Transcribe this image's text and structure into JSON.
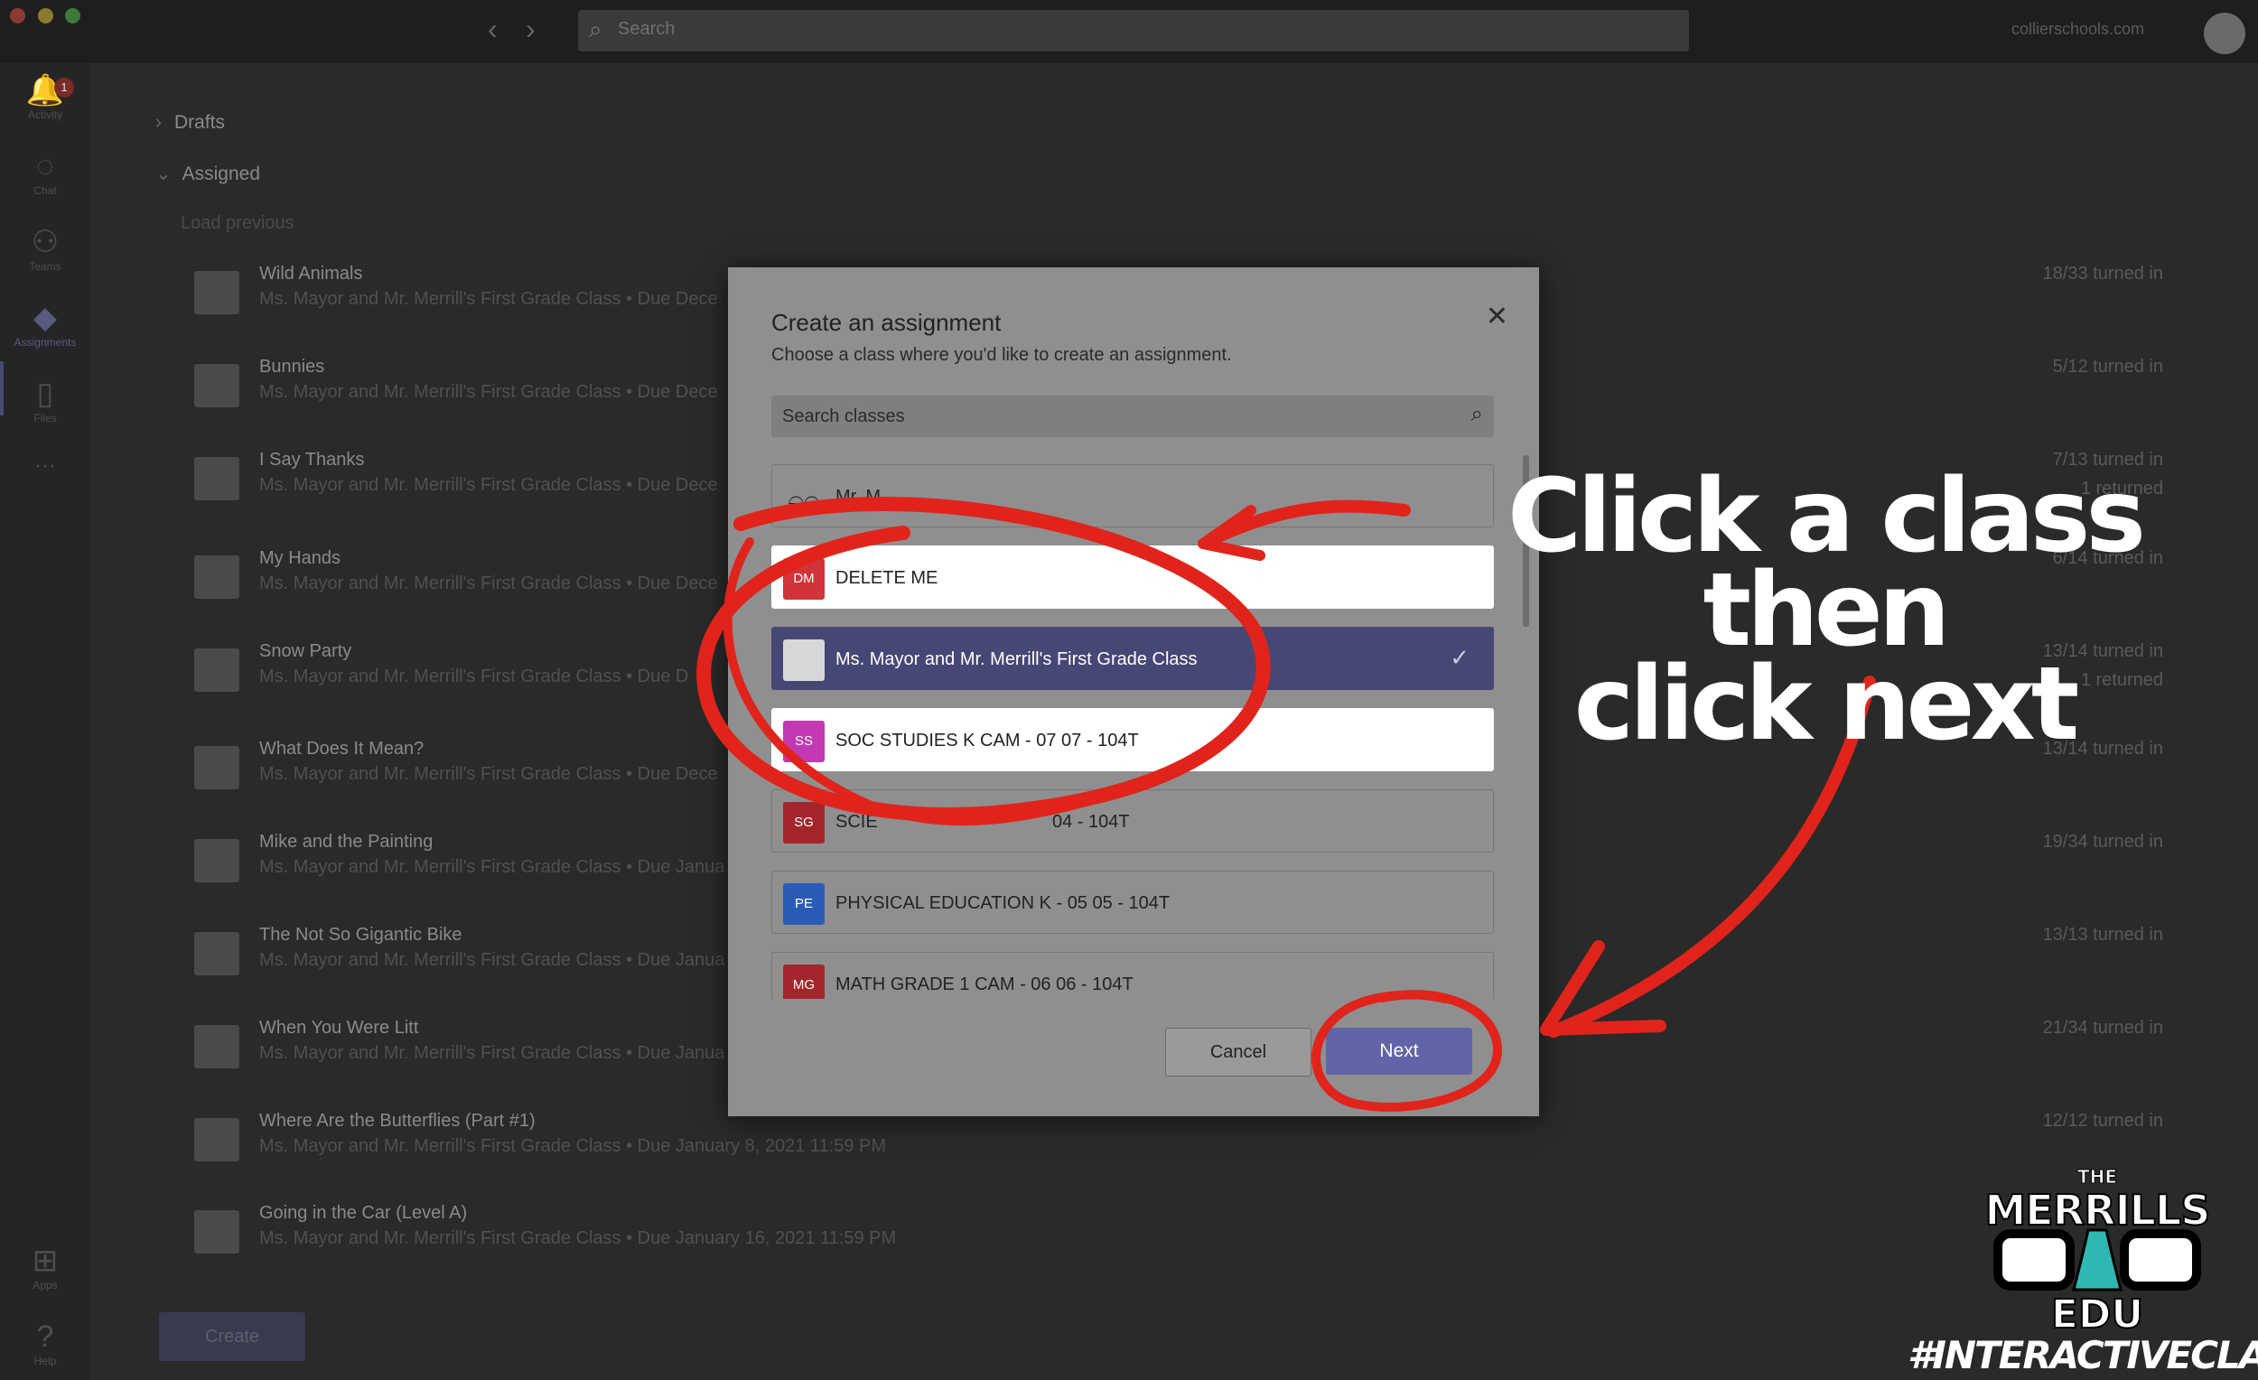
{
  "window": {
    "search_placeholder": "Search",
    "domain": "collierschools.com"
  },
  "rail": {
    "items": [
      {
        "label": "Activity",
        "icon": "bell-icon",
        "badge": "1"
      },
      {
        "label": "Chat",
        "icon": "chat-icon"
      },
      {
        "label": "Teams",
        "icon": "teams-icon"
      },
      {
        "label": "Assignments",
        "icon": "assignments-icon"
      },
      {
        "label": "Files",
        "icon": "file-icon"
      },
      {
        "label": "Apps",
        "icon": "apps-icon"
      },
      {
        "label": "Help",
        "icon": "help-icon"
      }
    ],
    "more": "···"
  },
  "list": {
    "drafts": "Drafts",
    "assigned": "Assigned",
    "load_previous": "Load previous",
    "assignments": [
      {
        "title": "Wild Animals",
        "sub": "Ms. Mayor and Mr. Merrill's First Grade Class • Due Dece",
        "count": "18/33 turned in",
        "returned": ""
      },
      {
        "title": "Bunnies",
        "sub": "Ms. Mayor and Mr. Merrill's First Grade Class • Due Dece",
        "count": "5/12 turned in",
        "returned": ""
      },
      {
        "title": "I Say Thanks",
        "sub": "Ms. Mayor and Mr. Merrill's First Grade Class • Due Dece",
        "count": "7/13 turned in",
        "returned": "1 returned"
      },
      {
        "title": "My Hands",
        "sub": "Ms. Mayor and Mr. Merrill's First Grade Class • Due Dece",
        "count": "6/14 turned in",
        "returned": ""
      },
      {
        "title": "Snow Party",
        "sub": "Ms. Mayor and Mr. Merrill's First Grade Class • Due D",
        "count": "13/14 turned in",
        "returned": "1 returned"
      },
      {
        "title": "What Does It Mean?",
        "sub": "Ms. Mayor and Mr. Merrill's First Grade Class • Due Dece",
        "count": "13/14 turned in",
        "returned": ""
      },
      {
        "title": "Mike and the Painting",
        "sub": "Ms. Mayor and Mr. Merrill's First Grade Class • Due Janua",
        "count": "19/34 turned in",
        "returned": ""
      },
      {
        "title": "The Not So Gigantic Bike",
        "sub": "Ms. Mayor and Mr. Merrill's First Grade Class • Due Janua",
        "count": "13/13 turned in",
        "returned": ""
      },
      {
        "title": "When You Were Litt",
        "sub": "Ms. Mayor and Mr. Merrill's First Grade Class • Due Janua",
        "count": "21/34 turned in",
        "returned": ""
      },
      {
        "title": "Where Are the Butterflies (Part #1)",
        "sub": "Ms. Mayor and Mr. Merrill's First Grade Class • Due January 8, 2021 11:59 PM",
        "count": "12/12 turned in",
        "returned": ""
      },
      {
        "title": "Going in the Car (Level A)",
        "sub": "Ms. Mayor and Mr. Merrill's First Grade Class • Due January 16, 2021 11:59 PM",
        "count": "",
        "returned": ""
      }
    ],
    "create": "Create"
  },
  "modal": {
    "title": "Create an assignment",
    "subtitle": "Choose a class where you'd like to create an assignment.",
    "search_placeholder": "Search classes",
    "classes": [
      {
        "initials": "",
        "name": "Mr. M",
        "color": "#2a2a2a",
        "state": "normal"
      },
      {
        "initials": "DM",
        "name": "DELETE ME",
        "color": "#d13438",
        "state": "highlight"
      },
      {
        "initials": "",
        "name": "Ms. Mayor and Mr. Merrill's First Grade Class",
        "color": "#c8c8c8",
        "state": "selected"
      },
      {
        "initials": "SS",
        "name": "SOC STUDIES K CAM - 07 07 - 104T",
        "color": "#c239b3",
        "state": "highlight"
      },
      {
        "initials": "SG",
        "name": "SCIE",
        "name_tail": "04 - 104T",
        "color": "#a4262c",
        "state": "normal"
      },
      {
        "initials": "PE",
        "name": "PHYSICAL EDUCATION K - 05 05 - 104T",
        "color": "#2b5bb6",
        "state": "normal"
      },
      {
        "initials": "MG",
        "name": "MATH GRADE 1 CAM - 06 06 - 104T",
        "color": "#a4262c",
        "state": "normal"
      }
    ],
    "cancel": "Cancel",
    "next": "Next"
  },
  "annotation": {
    "line1": "Click a class then",
    "line2": "click next",
    "color": "#e0241b"
  },
  "logo": {
    "the": "THE",
    "merrills": "MERRILLS",
    "edu": "EDU",
    "hashtag": "#INTERACTIVECLASS"
  }
}
